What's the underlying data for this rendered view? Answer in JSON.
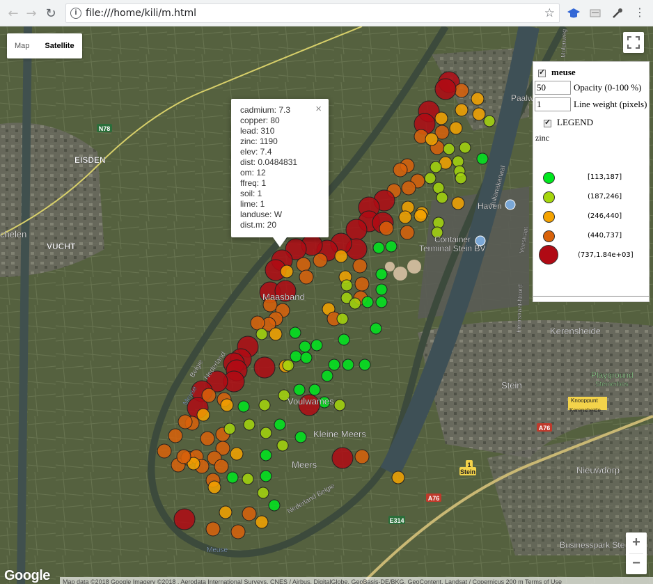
{
  "browser": {
    "url": "file:///home/kili/m.html"
  },
  "map_controls": {
    "map_label": "Map",
    "satellite_label": "Satellite",
    "zoom_in": "+",
    "zoom_out": "−"
  },
  "map_labels": [
    {
      "text": "EISDEN",
      "cls": "place"
    },
    {
      "text": "VUCHT",
      "cls": "place"
    },
    {
      "text": "chelen",
      "cls": "place"
    },
    {
      "text": "Maasband",
      "cls": "place"
    },
    {
      "text": "Voulwames",
      "cls": "place"
    },
    {
      "text": "Kleine Meers",
      "cls": "place"
    },
    {
      "text": "Meers",
      "cls": "place"
    },
    {
      "text": "Stein",
      "cls": "place"
    },
    {
      "text": "Kerensheide",
      "cls": "place"
    },
    {
      "text": "Nieuwdorp",
      "cls": "place"
    },
    {
      "text": "Haven",
      "cls": "place"
    },
    {
      "text": "Container",
      "cls": "place"
    },
    {
      "text": "Terminal Stein BV",
      "cls": "place"
    },
    {
      "text": "Paalwe",
      "cls": "place"
    },
    {
      "text": "Playground",
      "cls": "green"
    },
    {
      "text": "Steinerbos",
      "cls": "green"
    },
    {
      "text": "Businesspark Ste",
      "cls": "place"
    },
    {
      "text": "Meuse",
      "cls": "water"
    },
    {
      "text": "Meuse",
      "cls": "water"
    },
    {
      "text": "Belgie",
      "cls": "small"
    },
    {
      "text": "Nederland",
      "cls": "small"
    },
    {
      "text": "Nederland Belgie",
      "cls": "small"
    },
    {
      "text": "Julianakanaal",
      "cls": "small"
    },
    {
      "text": "Heerstraat-Noord",
      "cls": "small"
    },
    {
      "text": "Veestraat",
      "cls": "small"
    },
    {
      "text": "Molenweg",
      "cls": "small"
    },
    {
      "text": "Knooppunt",
      "cls": "shield"
    },
    {
      "text": "Kerensheide",
      "cls": "shield"
    }
  ],
  "road_shields": [
    "N78",
    "A76",
    "A76",
    "E314",
    "1",
    "Stein"
  ],
  "google_logo": "Google",
  "attribution": "Map data ©2018 Google Imagery ©2018 , Aerodata International Surveys, CNES / Airbus, DigitalGlobe, GeoBasis-DE/BKG, GeoContent, Landsat / Copernicus  200 m  Terms of Use",
  "popup": {
    "rows": [
      "cadmium: 7.3",
      "copper: 80",
      "lead: 310",
      "zinc: 1190",
      "elev: 7.4",
      "dist: 0.0484831",
      "om: 12",
      "ffreq: 1",
      "soil: 1",
      "lime: 1",
      "landuse: W",
      "dist.m: 20"
    ],
    "close_icon": "×"
  },
  "layer_panel": {
    "layer_name": "meuse",
    "opacity_value": "50",
    "opacity_label": "Opacity (0-100 %)",
    "lineweight_value": "1",
    "lineweight_label": "Line weight (pixels)",
    "legend_label": "LEGEND",
    "variable": "zinc",
    "legend": [
      {
        "label": "[113,187]",
        "color": "#00e81e"
      },
      {
        "label": "(187,246]",
        "color": "#a5d60d"
      },
      {
        "label": "(246,440]",
        "color": "#f5a300"
      },
      {
        "label": "(440,737]",
        "color": "#d9620a"
      },
      {
        "label": "(737,1.84e+03]",
        "color": "#b00a14"
      }
    ]
  }
}
